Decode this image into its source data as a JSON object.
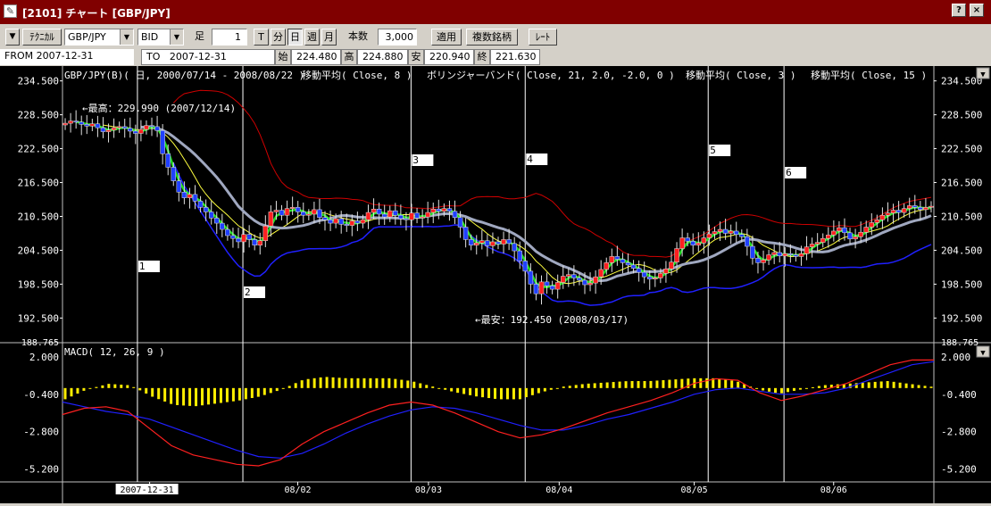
{
  "window": {
    "title": "[2101] チャート [GBP/JPY]",
    "help": "?",
    "close": "×"
  },
  "toolbar": {
    "menu_arrow": "▼",
    "technical": "ﾃｸﾆｶﾙ",
    "symbol": "GBP/JPY",
    "price_type": "BID",
    "ashi_label": "足",
    "period_value": "1",
    "tick_label": "T",
    "min_label": "分",
    "day_label": "日",
    "week_label": "週",
    "month_label": "月",
    "bars_label": "本数",
    "bars_value": "3,000",
    "apply": "適用",
    "multi": "複数銘柄",
    "rate": "ﾚｰﾄ"
  },
  "info": {
    "from_label": "FROM",
    "from_date": "2007-12-31",
    "to_label": "TO",
    "to_date": "2007-12-31",
    "open_label": "始",
    "open": "224.480",
    "high_label": "高",
    "high": "224.880",
    "low_label": "安",
    "low": "220.940",
    "close_label": "終",
    "close": "221.630"
  },
  "colors": {
    "background": "#000000",
    "candle_up": "#ff2020",
    "candle_down": "#2040ff",
    "ma8": "#ffff40",
    "bb_band": "#d00000",
    "bb_mid": "#2020ff",
    "ma3": "#20e020",
    "ma15": "#a0a8c0",
    "macd": "#ff2020",
    "signal": "#2020ff",
    "hist": "#ffee00"
  },
  "chart_data": [
    {
      "type": "candlestick",
      "panel": "price",
      "legend": [
        "GBP/JPY(B)( 日, 2000/07/14 - 2008/08/22 )",
        "移動平均( Close, 8 )",
        "ボリンジャーバンド( Close, 21, 2.0, -2.0, 0 )",
        "移動平均( Close, 3 )",
        "移動平均( Close, 15 )"
      ],
      "y_ticks": [
        "234.500",
        "228.500",
        "222.500",
        "216.500",
        "210.500",
        "204.500",
        "198.500",
        "192.500"
      ],
      "y_bottom_label": "188.765",
      "ylim": [
        188.765,
        236.5
      ],
      "x_ticks": [
        "2007-12-31",
        "08/02",
        "08/03",
        "08/04",
        "08/05",
        "08/06"
      ],
      "annotations": {
        "high": "←最高：229.990 (2007/12/14)",
        "low": "←最安：192.450 (2008/03/17)"
      },
      "markers": [
        "1",
        "2",
        "3",
        "4",
        "5",
        "6"
      ],
      "close_series": [
        227.0,
        227.4,
        227.2,
        226.8,
        226.5,
        226.9,
        226.2,
        225.5,
        225.8,
        226.2,
        226.4,
        226.1,
        225.6,
        225.2,
        225.9,
        226.6,
        226.4,
        225.7,
        221.6,
        219.2,
        216.8,
        214.8,
        213.8,
        214.4,
        213.2,
        212.1,
        211.3,
        210.2,
        209.3,
        208.2,
        207.1,
        206.6,
        206.0,
        207.3,
        206.4,
        205.4,
        206.2,
        208.8,
        211.3,
        211.6,
        210.7,
        211.9,
        212.1,
        211.3,
        210.7,
        210.9,
        211.7,
        210.3,
        209.9,
        209.3,
        210.1,
        209.1,
        208.9,
        209.7,
        209.3,
        209.9,
        211.2,
        211.8,
        210.9,
        210.4,
        211.5,
        210.7,
        210.1,
        209.9,
        211.1,
        210.2,
        210.4,
        211.2,
        211.8,
        211.4,
        211.9,
        211.4,
        210.3,
        208.6,
        206.4,
        205.4,
        205.8,
        206.2,
        205.3,
        206.0,
        205.6,
        206.4,
        205.7,
        204.4,
        202.6,
        200.8,
        198.5,
        196.8,
        198.9,
        198.2,
        197.6,
        198.8,
        199.9,
        200.2,
        199.6,
        199.2,
        198.4,
        198.7,
        199.8,
        201.1,
        202.3,
        203.4,
        202.9,
        202.3,
        201.9,
        201.3,
        200.6,
        199.8,
        199.4,
        199.6,
        200.4,
        201.2,
        202.4,
        204.8,
        206.7,
        206.1,
        205.4,
        205.8,
        206.7,
        207.4,
        207.8,
        208.2,
        207.5,
        207.9,
        207.3,
        206.9,
        205.2,
        203.1,
        202.3,
        202.8,
        203.7,
        204.1,
        203.5,
        203.9,
        203.7,
        203.4,
        203.9,
        205.1,
        205.6,
        205.9,
        206.6,
        207.2,
        207.9,
        208.5,
        207.6,
        206.5,
        206.9,
        207.7,
        208.6,
        209.4,
        209.9,
        210.7,
        211.1,
        211.6,
        211.2,
        211.9,
        212.4,
        212.1,
        211.7,
        212.1,
        212.3
      ]
    },
    {
      "type": "line",
      "panel": "macd",
      "legend": "MACD( 12, 26, 9 )",
      "y_ticks": [
        "2.000",
        "-0.400",
        "-2.800",
        "-5.200"
      ],
      "ylim": [
        -5.8,
        2.8
      ],
      "series": [
        {
          "name": "MACD",
          "values": [
            -1.7,
            -1.3,
            -1.2,
            -1.5,
            -2.6,
            -3.7,
            -4.3,
            -4.6,
            -4.9,
            -5.0,
            -4.6,
            -3.6,
            -2.8,
            -2.2,
            -1.6,
            -1.1,
            -0.9,
            -1.1,
            -1.6,
            -2.2,
            -2.8,
            -3.2,
            -3.0,
            -2.6,
            -2.1,
            -1.6,
            -1.2,
            -0.8,
            -0.3,
            0.3,
            0.6,
            0.5,
            -0.3,
            -0.8,
            -0.5,
            -0.1,
            0.3,
            0.9,
            1.5,
            1.8,
            1.8
          ]
        },
        {
          "name": "Signal",
          "values": [
            -0.9,
            -1.2,
            -1.5,
            -1.7,
            -2.0,
            -2.5,
            -3.0,
            -3.5,
            -4.0,
            -4.4,
            -4.5,
            -4.2,
            -3.6,
            -2.9,
            -2.3,
            -1.8,
            -1.4,
            -1.2,
            -1.3,
            -1.6,
            -2.0,
            -2.4,
            -2.7,
            -2.7,
            -2.4,
            -2.0,
            -1.7,
            -1.3,
            -0.9,
            -0.4,
            -0.1,
            0.0,
            -0.2,
            -0.4,
            -0.4,
            -0.3,
            0.0,
            0.5,
            1.0,
            1.5,
            1.7
          ]
        }
      ]
    }
  ]
}
